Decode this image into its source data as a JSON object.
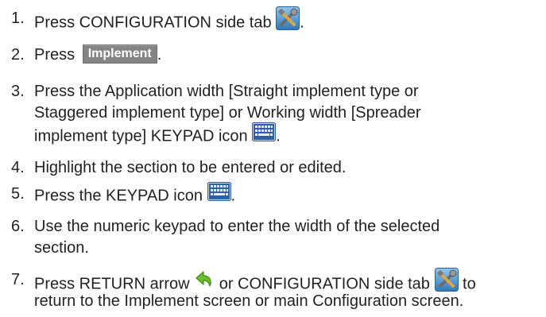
{
  "steps": [
    {
      "number": "1.",
      "lines": [
        {
          "a": "Press CONFIGURATION side tab ",
          "icon": "configuration-tools-icon",
          "b": "."
        }
      ]
    },
    {
      "number": "2.",
      "lines": [
        {
          "a": "Press ",
          "button": "Implement",
          "b": "."
        }
      ]
    },
    {
      "number": "3.",
      "lines": [
        {
          "a": "Press the Application width [Straight implement type or"
        },
        {
          "a": "Staggered implement type] or Working width [Spreader"
        },
        {
          "a": "implement type] KEYPAD icon ",
          "icon": "keypad-icon",
          "b": "."
        }
      ]
    },
    {
      "number": "4.",
      "lines": [
        {
          "a": "Highlight the section to be entered or edited."
        }
      ]
    },
    {
      "number": "5.",
      "lines": [
        {
          "a": "Press the KEYPAD icon ",
          "icon": "keypad-icon",
          "b": "."
        }
      ]
    },
    {
      "number": "6.",
      "lines": [
        {
          "a": "Use the numeric keypad to enter the width of the selected"
        },
        {
          "a": "section."
        }
      ]
    },
    {
      "number": "7.",
      "lines": [
        {
          "a": "Press RETURN arrow ",
          "icon": "return-arrow-icon",
          "b": " or CONFIGURATION side tab ",
          "icon2": "configuration-tools-icon",
          "c": " to"
        },
        {
          "a": "return to the Implement screen or main Configuration screen."
        }
      ]
    }
  ]
}
